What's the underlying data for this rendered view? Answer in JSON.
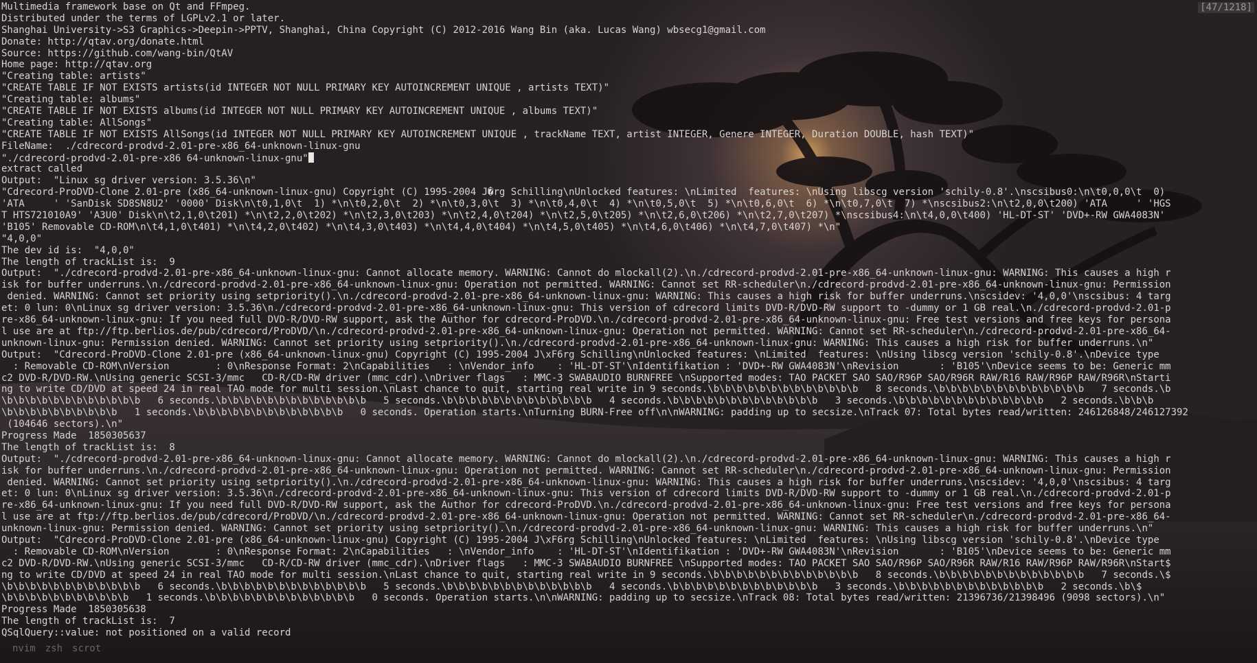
{
  "scroll_indicator": "[47/1218]",
  "lines": [
    "Multimedia framework base on Qt and FFmpeg.",
    "Distributed under the terms of LGPLv2.1 or later.",
    "Shanghai University->S3 Graphics->Deepin->PPTV, Shanghai, China Copyright (C) 2012-2016 Wang Bin (aka. Lucas Wang) wbsecg1@gmail.com",
    "Donate: http://qtav.org/donate.html",
    "Source: https://github.com/wang-bin/QtAV",
    "Home page: http://qtav.org",
    "\"Creating table: artists\"",
    "\"CREATE TABLE IF NOT EXISTS artists(id INTEGER NOT NULL PRIMARY KEY AUTOINCREMENT UNIQUE , artists TEXT)\"",
    "\"Creating table: albums\"",
    "\"CREATE TABLE IF NOT EXISTS albums(id INTEGER NOT NULL PRIMARY KEY AUTOINCREMENT UNIQUE , albums TEXT)\"",
    "\"Creating table: AllSongs\"",
    "\"CREATE TABLE IF NOT EXISTS AllSongs(id INTEGER NOT NULL PRIMARY KEY AUTOINCREMENT UNIQUE , trackName TEXT, artist INTEGER, Genere INTEGER, Duration DOUBLE, hash TEXT)\"",
    "FileName:  ./cdrecord-prodvd-2.01-pre-x86_64-unknown-linux-gnu",
    "\"./cdrecord-prodvd-2.01-pre-x86_64-unknown-linux-gnu\"",
    "extract called",
    "Output:  \"Linux sg driver version: 3.5.36\\n\"",
    "\"Cdrecord-ProDVD-Clone 2.01-pre (x86_64-unknown-linux-gnu) Copyright (C) 1995-2004 J�rg Schilling\\nUnlocked features: \\nLimited  features: \\nUsing libscg version 'schily-0.8'.\\nscsibus0:\\n\\t0,0,0\\t  0)",
    "'ATA     ' 'SanDisk SD8SN8U2' '0000' Disk\\n\\t0,1,0\\t  1) *\\n\\t0,2,0\\t  2) *\\n\\t0,3,0\\t  3) *\\n\\t0,4,0\\t  4) *\\n\\t0,5,0\\t  5) *\\n\\t0,6,0\\t  6) *\\n\\t0,7,0\\t  7) *\\nscsibus2:\\n\\t2,0,0\\t200) 'ATA     ' 'HGS",
    "T HTS721010A9' 'A3U0' Disk\\n\\t2,1,0\\t201) *\\n\\t2,2,0\\t202) *\\n\\t2,3,0\\t203) *\\n\\t2,4,0\\t204) *\\n\\t2,5,0\\t205) *\\n\\t2,6,0\\t206) *\\n\\t2,7,0\\t207) *\\nscsibus4:\\n\\t4,0,0\\t400) 'HL-DT-ST' 'DVD+-RW GWA4083N'",
    "'B105' Removable CD-ROM\\n\\t4,1,0\\t401) *\\n\\t4,2,0\\t402) *\\n\\t4,3,0\\t403) *\\n\\t4,4,0\\t404) *\\n\\t4,5,0\\t405) *\\n\\t4,6,0\\t406) *\\n\\t4,7,0\\t407) *\\n\"",
    "\"4,0,0\"",
    "The dev id is:  \"4,0,0\"",
    "The length of trackList is:  9",
    "Output:  \"./cdrecord-prodvd-2.01-pre-x86_64-unknown-linux-gnu: Cannot allocate memory. WARNING: Cannot do mlockall(2).\\n./cdrecord-prodvd-2.01-pre-x86_64-unknown-linux-gnu: WARNING: This causes a high r",
    "isk for buffer underruns.\\n./cdrecord-prodvd-2.01-pre-x86_64-unknown-linux-gnu: Operation not permitted. WARNING: Cannot set RR-scheduler\\n./cdrecord-prodvd-2.01-pre-x86_64-unknown-linux-gnu: Permission",
    " denied. WARNING: Cannot set priority using setpriority().\\n./cdrecord-prodvd-2.01-pre-x86_64-unknown-linux-gnu: WARNING: This causes a high risk for buffer underruns.\\nscsidev: '4,0,0'\\nscsibus: 4 targ",
    "et: 0 lun: 0\\nLinux sg driver version: 3.5.36\\n./cdrecord-prodvd-2.01-pre-x86_64-unknown-linux-gnu: This version of cdrecord limits DVD-R/DVD-RW support to -dummy or 1 GB real.\\n./cdrecord-prodvd-2.01-p",
    "re-x86_64-unknown-linux-gnu: If you need full DVD-R/DVD-RW support, ask the Author for cdrecord-ProDVD.\\n./cdrecord-prodvd-2.01-pre-x86_64-unknown-linux-gnu: Free test versions and free keys for persona",
    "l use are at ftp://ftp.berlios.de/pub/cdrecord/ProDVD/\\n./cdrecord-prodvd-2.01-pre-x86_64-unknown-linux-gnu: Operation not permitted. WARNING: Cannot set RR-scheduler\\n./cdrecord-prodvd-2.01-pre-x86_64-",
    "unknown-linux-gnu: Permission denied. WARNING: Cannot set priority using setpriority().\\n./cdrecord-prodvd-2.01-pre-x86_64-unknown-linux-gnu: WARNING: This causes a high risk for buffer underruns.\\n\"",
    "Output:  \"Cdrecord-ProDVD-Clone 2.01-pre (x86_64-unknown-linux-gnu) Copyright (C) 1995-2004 J\\xF6rg Schilling\\nUnlocked features: \\nLimited  features: \\nUsing libscg version 'schily-0.8'.\\nDevice type",
    "  : Removable CD-ROM\\nVersion        : 0\\nResponse Format: 2\\nCapabilities   : \\nVendor_info    : 'HL-DT-ST'\\nIdentifikation : 'DVD+-RW GWA4083N'\\nRevision       : 'B105'\\nDevice seems to be: Generic mm",
    "c2 DVD-R/DVD-RW.\\nUsing generic SCSI-3/mmc   CD-R/CD-RW driver (mmc_cdr).\\nDriver flags   : MMC-3 SWABAUDIO BURNFREE \\nSupported modes: TAO PACKET SAO SAO/R96P SAO/R96R RAW/R16 RAW/R96P RAW/R96R\\nStarti",
    "ng to write CD/DVD at speed 24 in real TAO mode for multi session.\\nLast chance to quit, starting real write in 9 seconds.\\b\\b\\b\\b\\b\\b\\b\\b\\b\\b\\b\\b\\b   8 seconds.\\b\\b\\b\\b\\b\\b\\b\\b\\b\\b\\b\\b\\b   7 seconds.\\b",
    "\\b\\b\\b\\b\\b\\b\\b\\b\\b\\b\\b\\b   6 seconds.\\b\\b\\b\\b\\b\\b\\b\\b\\b\\b\\b\\b\\b   5 seconds.\\b\\b\\b\\b\\b\\b\\b\\b\\b\\b\\b\\b\\b   4 seconds.\\b\\b\\b\\b\\b\\b\\b\\b\\b\\b\\b\\b\\b   3 seconds.\\b\\b\\b\\b\\b\\b\\b\\b\\b\\b\\b\\b\\b   2 seconds.\\b\\b\\b",
    "\\b\\b\\b\\b\\b\\b\\b\\b\\b\\b   1 seconds.\\b\\b\\b\\b\\b\\b\\b\\b\\b\\b\\b\\b\\b   0 seconds. Operation starts.\\nTurning BURN-Free off\\n\\nWARNING: padding up to secsize.\\nTrack 07: Total bytes read/written: 246126848/246127392",
    " (104646 sectors).\\n\"",
    "Progress Made  1850305637",
    "The length of trackList is:  8",
    "Output:  \"./cdrecord-prodvd-2.01-pre-x86_64-unknown-linux-gnu: Cannot allocate memory. WARNING: Cannot do mlockall(2).\\n./cdrecord-prodvd-2.01-pre-x86_64-unknown-linux-gnu: WARNING: This causes a high r",
    "isk for buffer underruns.\\n./cdrecord-prodvd-2.01-pre-x86_64-unknown-linux-gnu: Operation not permitted. WARNING: Cannot set RR-scheduler\\n./cdrecord-prodvd-2.01-pre-x86_64-unknown-linux-gnu: Permission",
    " denied. WARNING: Cannot set priority using setpriority().\\n./cdrecord-prodvd-2.01-pre-x86_64-unknown-linux-gnu: WARNING: This causes a high risk for buffer underruns.\\nscsidev: '4,0,0'\\nscsibus: 4 targ",
    "et: 0 lun: 0\\nLinux sg driver version: 3.5.36\\n./cdrecord-prodvd-2.01-pre-x86_64-unknown-linux-gnu: This version of cdrecord limits DVD-R/DVD-RW support to -dummy or 1 GB real.\\n./cdrecord-prodvd-2.01-p",
    "re-x86_64-unknown-linux-gnu: If you need full DVD-R/DVD-RW support, ask the Author for cdrecord-ProDVD.\\n./cdrecord-prodvd-2.01-pre-x86_64-unknown-linux-gnu: Free test versions and free keys for persona",
    "l use are at ftp://ftp.berlios.de/pub/cdrecord/ProDVD/\\n./cdrecord-prodvd-2.01-pre-x86_64-unknown-linux-gnu: Operation not permitted. WARNING: Cannot set RR-scheduler\\n./cdrecord-prodvd-2.01-pre-x86_64-",
    "unknown-linux-gnu: Permission denied. WARNING: Cannot set priority using setpriority().\\n./cdrecord-prodvd-2.01-pre-x86_64-unknown-linux-gnu: WARNING: This causes a high risk for buffer underruns.\\n\"",
    "Output:  \"Cdrecord-ProDVD-Clone 2.01-pre (x86_64-unknown-linux-gnu) Copyright (C) 1995-2004 J\\xF6rg Schilling\\nUnlocked features: \\nLimited  features: \\nUsing libscg version 'schily-0.8'.\\nDevice type",
    "  : Removable CD-ROM\\nVersion        : 0\\nResponse Format: 2\\nCapabilities   : \\nVendor_info    : 'HL-DT-ST'\\nIdentifikation : 'DVD+-RW GWA4083N'\\nRevision       : 'B105'\\nDevice seems to be: Generic mm",
    "c2 DVD-R/DVD-RW.\\nUsing generic SCSI-3/mmc   CD-R/CD-RW driver (mmc_cdr).\\nDriver flags   : MMC-3 SWABAUDIO BURNFREE \\nSupported modes: TAO PACKET SAO SAO/R96P SAO/R96R RAW/R16 RAW/R96P RAW/R96R\\nStart$",
    "ng to write CD/DVD at speed 24 in real TAO mode for multi session.\\nLast chance to quit, starting real write in 9 seconds.\\b\\b\\b\\b\\b\\b\\b\\b\\b\\b\\b\\b\\b   8 seconds.\\b\\b\\b\\b\\b\\b\\b\\b\\b\\b\\b\\b\\b   7 seconds.\\$",
    "\\b\\b\\b\\b\\b\\b\\b\\b\\b\\b\\b\\b   6 seconds.\\b\\b\\b\\b\\b\\b\\b\\b\\b\\b\\b\\b\\b   5 seconds.\\b\\b\\b\\b\\b\\b\\b\\b\\b\\b\\b\\b\\b   4 seconds.\\b\\b\\b\\b\\b\\b\\b\\b\\b\\b\\b\\b\\b   3 seconds.\\b\\b\\b\\b\\b\\b\\b\\b\\b\\b\\b\\b\\b   2 seconds.\\b\\$",
    "\\b\\b\\b\\b\\b\\b\\b\\b\\b\\b\\b   1 seconds.\\b\\b\\b\\b\\b\\b\\b\\b\\b\\b\\b\\b\\b   0 seconds. Operation starts.\\n\\nWARNING: padding up to secsize.\\nTrack 08: Total bytes read/written: 21396736/21398496 (9098 sectors).\\n\"",
    "Progress Made  1850305638",
    "The length of trackList is:  7",
    "QSqlQuery::value: not positioned on a valid record"
  ],
  "cursor_line_index": 13,
  "status_tabs": [
    "nvim",
    "zsh",
    "scrot"
  ],
  "colors": {
    "text": "#d8d4d0",
    "status_text": "#6a6562",
    "cursor": "#e8e6e2"
  }
}
